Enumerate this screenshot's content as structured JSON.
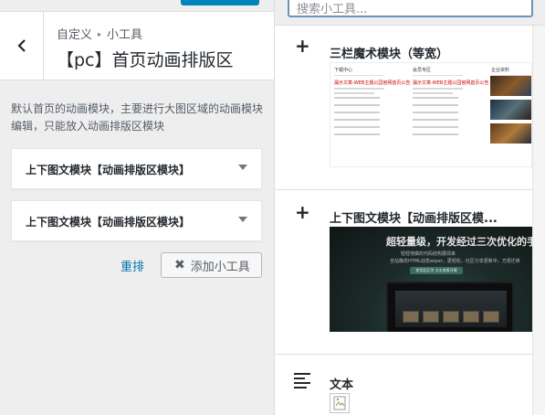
{
  "header": {
    "breadcrumb": {
      "parent": "自定义",
      "current": "小工具"
    },
    "title": "【pc】首页动画排版区"
  },
  "description": "默认首页的动画模块，主要进行大图区域的动画模块编辑，只能放入动画排版区模块",
  "area_widgets": [
    {
      "title": "上下图文模块【动画排版区模块】"
    },
    {
      "title": "上下图文模块【动画排版区模块】"
    }
  ],
  "actions": {
    "reorder_label": "重排",
    "add_widget_label": "添加小工具"
  },
  "search": {
    "placeholder": "搜索小工具..."
  },
  "available_widgets": [
    {
      "title": "三栏魔术模块（等宽）",
      "icon": "plus-icon",
      "preview": {
        "columns": [
          {
            "header": "下载中心",
            "headline": "漏示文章-WEB主题公园官网首页公告"
          },
          {
            "header": "会员专区",
            "headline": "漏示文章-WEB主题公园官网首页公告"
          },
          {
            "header": "企业资料",
            "headline": ""
          }
        ]
      }
    },
    {
      "title": "上下图文模块【动画排版区模...",
      "icon": "plus-icon",
      "preview": {
        "headline": "超轻量级，开发经过三次优化的手写代码",
        "line1": "轻轻地做的代码结构展现来",
        "line2": "全站静态HTML动态wiper，更轻松，社区分享更新中，方便迁移",
        "button": "使用此区块 点击查看详情"
      }
    },
    {
      "title": "文本",
      "icon": "text-lines-icon"
    }
  ],
  "colors": {
    "accent": "#0073aa",
    "publish_button": "#0085ba",
    "panel_bg": "#eeeeee"
  }
}
